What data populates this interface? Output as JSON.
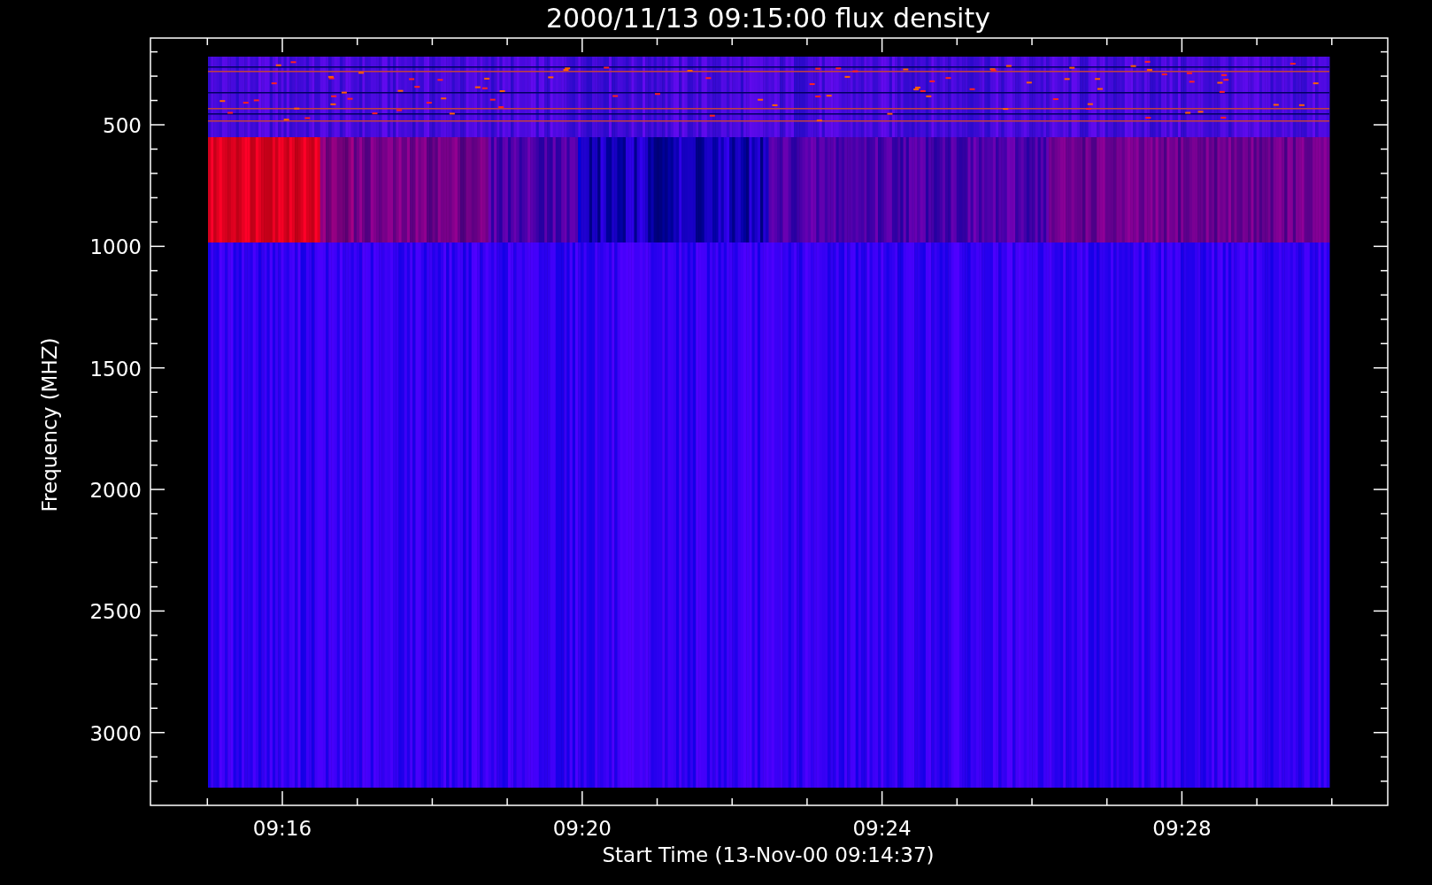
{
  "title": "2000/11/13 09:15:00 flux density",
  "x_axis": {
    "label": "Start Time (13-Nov-00 09:14:37)",
    "ticks": [
      "09:16",
      "09:20",
      "09:24",
      "09:28"
    ]
  },
  "y_axis": {
    "label": "Frequency (MHZ)",
    "ticks": [
      "500",
      "1000",
      "1500",
      "2000",
      "2500",
      "3000"
    ]
  }
}
